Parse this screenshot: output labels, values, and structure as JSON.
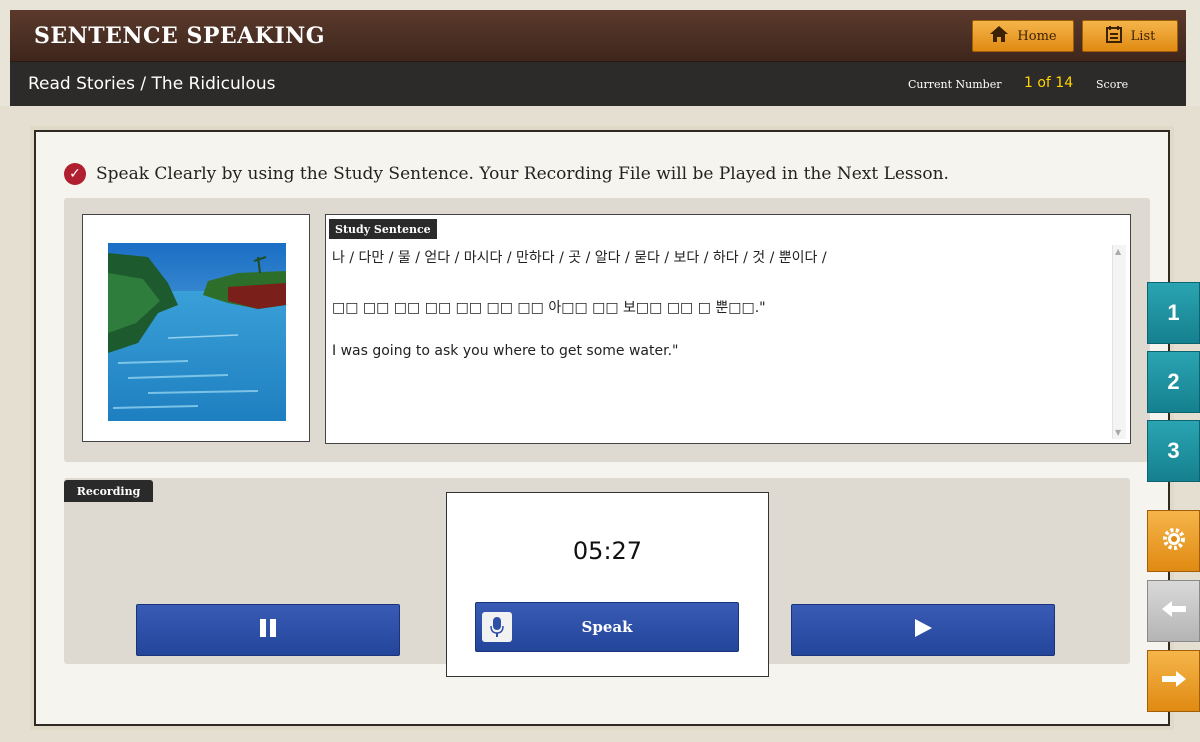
{
  "header": {
    "title": "SENTENCE SPEAKING",
    "home_label": "Home",
    "list_label": "List"
  },
  "subheader": {
    "breadcrumb": "Read Stories / The Ridiculous",
    "current_number_label": "Current Number",
    "current_number_value": "1 of 14",
    "score_label": "Score"
  },
  "instruction": "Speak Clearly by using the Study Sentence. Your Recording File will be Played in the Next Lesson.",
  "study": {
    "tab_label": "Study Sentence",
    "words_line": "나 / 다만 / 물 / 얻다 / 마시다 / 만하다 / 곳 / 알다 / 묻다 / 보다 / 하다 / 것 / 뿐이다 /",
    "korean_line": "□□ □□ □□ □□ □□ □□ □□ 아□□ □□ 보□□ □□ □ 뿐□□.\"",
    "english_line": "I was going to ask you where to get some water.\""
  },
  "recording": {
    "tab_label": "Recording",
    "timer": "05:27",
    "speak_label": "Speak"
  },
  "side_nav": {
    "items": [
      "1",
      "2",
      "3"
    ]
  },
  "colors": {
    "header_bg": "#4a2e22",
    "accent_orange": "#f0a030",
    "teal": "#1c8f9e",
    "blue_button": "#2e4fa8",
    "current_number": "#ffd400"
  }
}
